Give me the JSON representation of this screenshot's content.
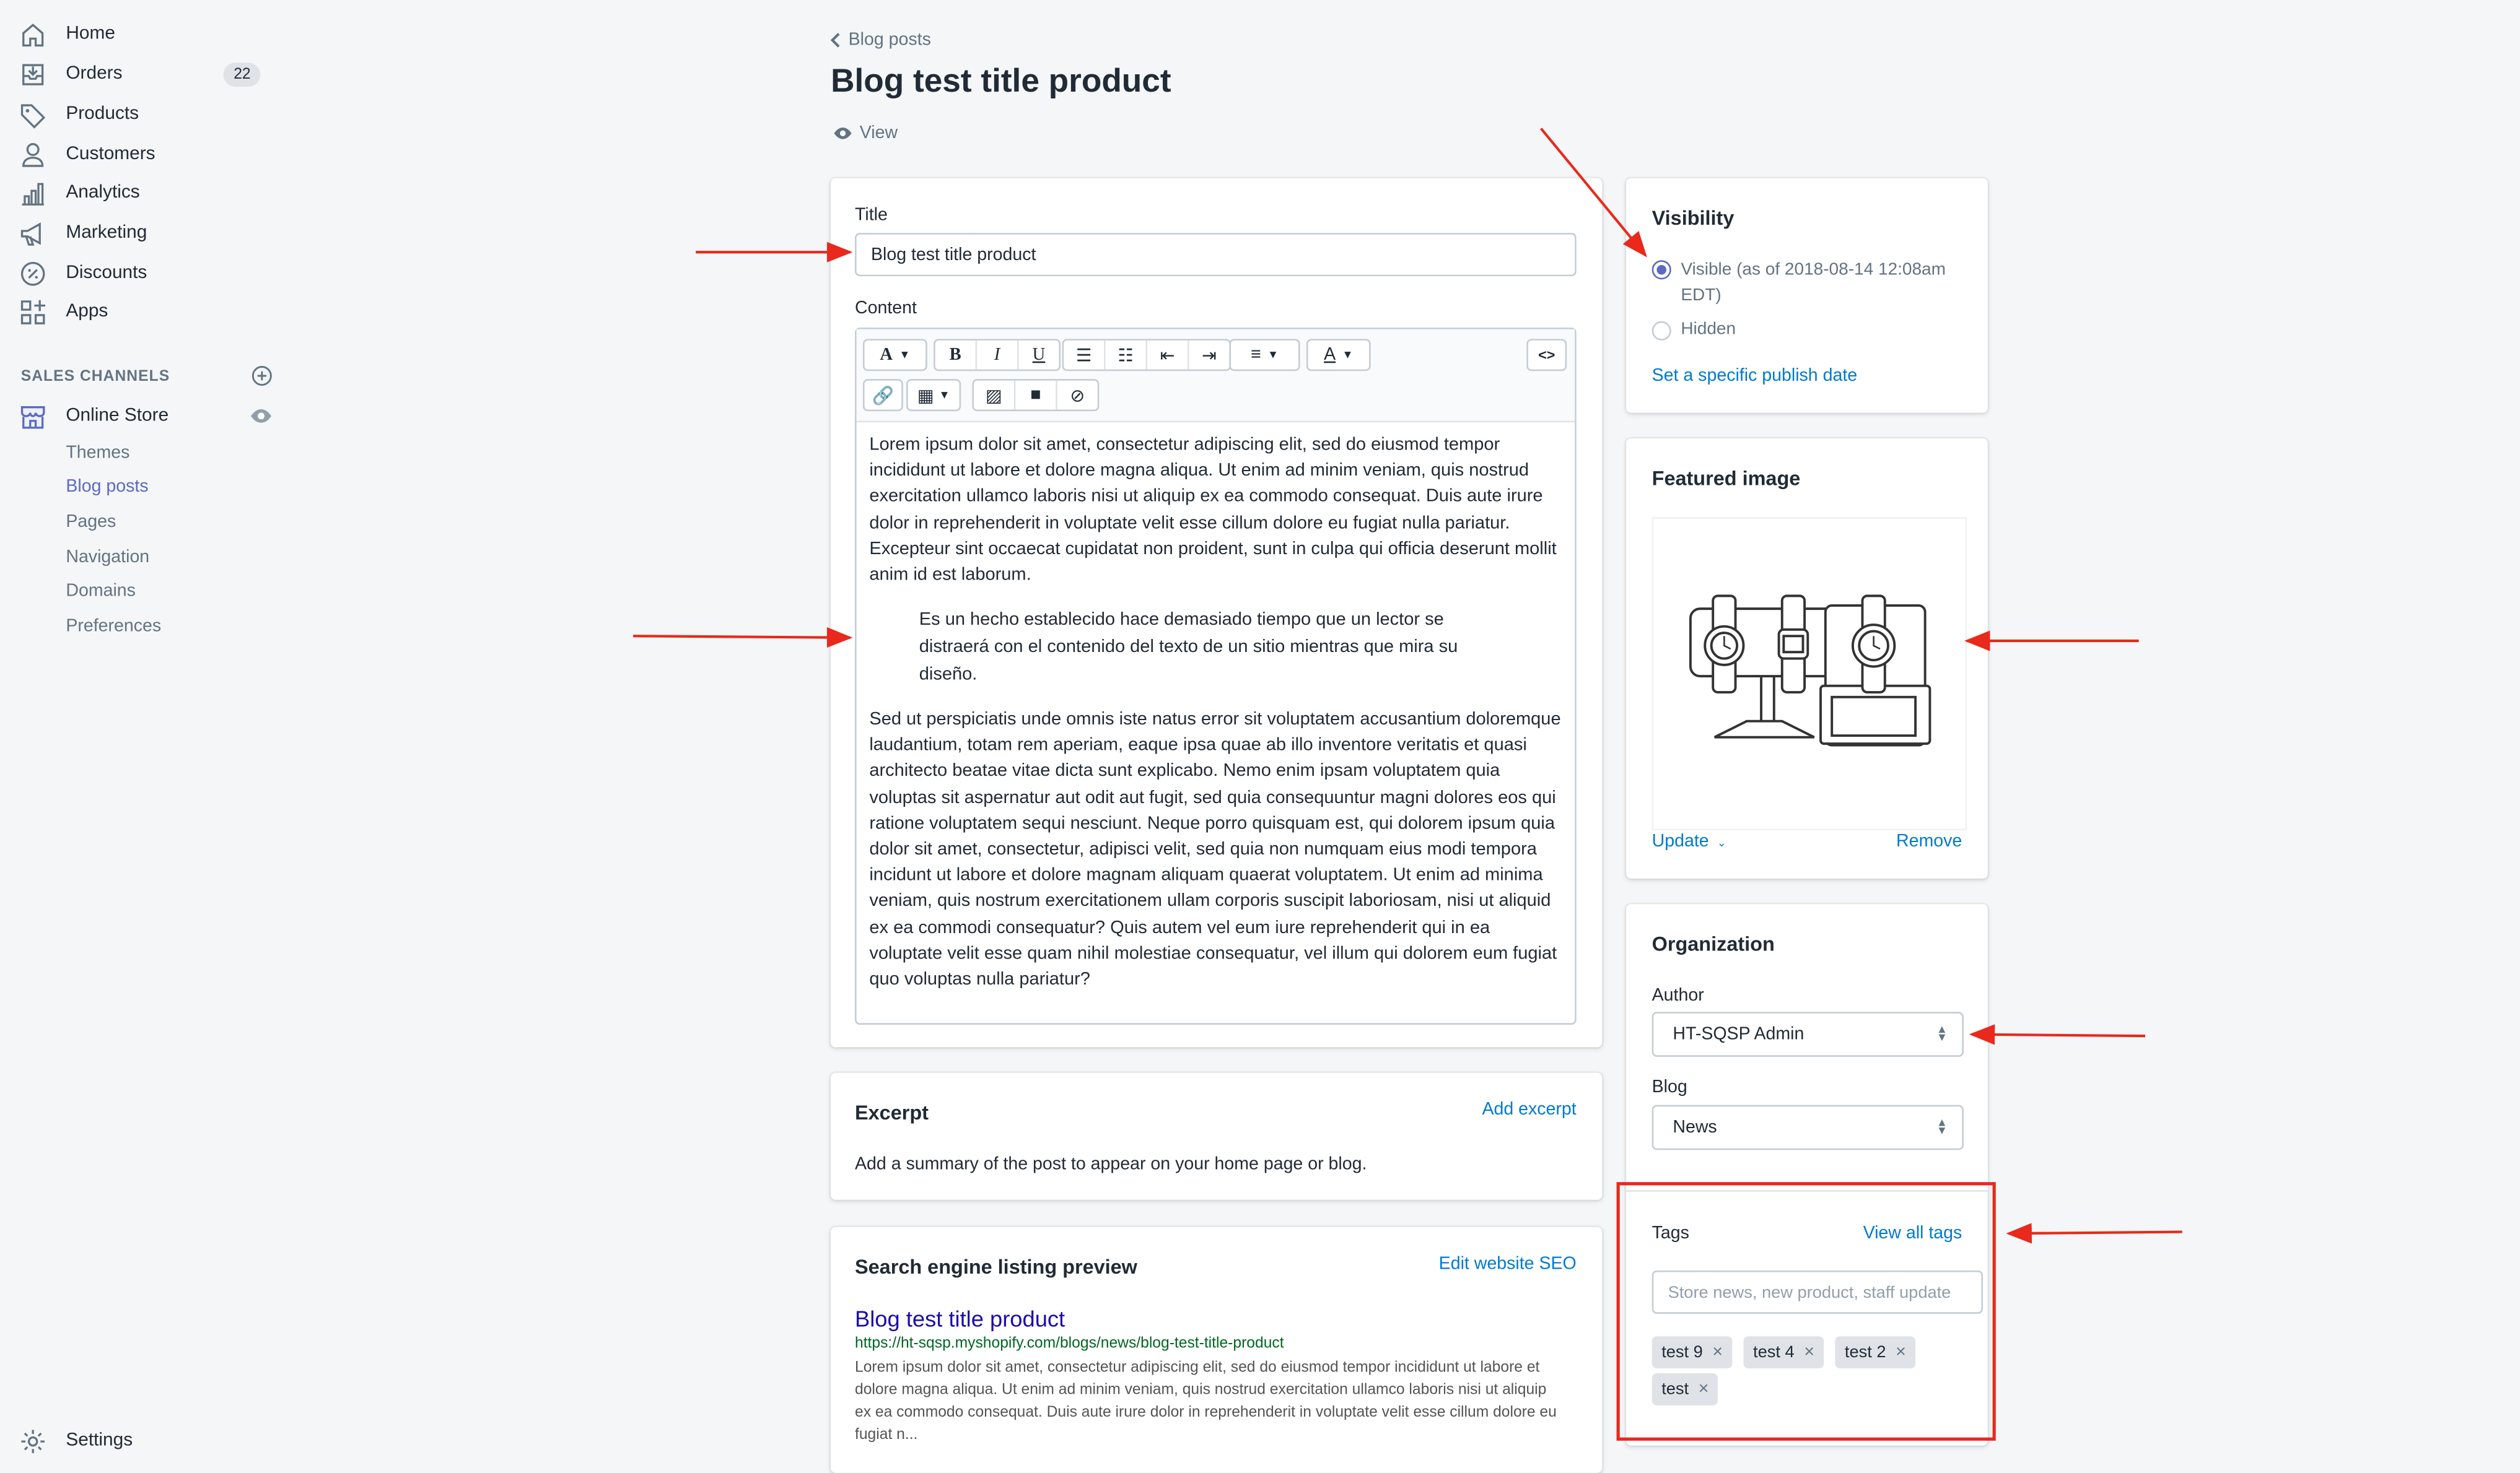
{
  "sidebar": {
    "items": [
      {
        "label": "Home",
        "icon": "home-icon"
      },
      {
        "label": "Orders",
        "icon": "orders-icon",
        "badge": "22"
      },
      {
        "label": "Products",
        "icon": "tag-icon"
      },
      {
        "label": "Customers",
        "icon": "person-icon"
      },
      {
        "label": "Analytics",
        "icon": "bar-chart-icon"
      },
      {
        "label": "Marketing",
        "icon": "megaphone-icon"
      },
      {
        "label": "Discounts",
        "icon": "discount-icon"
      },
      {
        "label": "Apps",
        "icon": "apps-icon"
      }
    ],
    "sales_channels_title": "SALES CHANNELS",
    "online_store": "Online Store",
    "sub_items": [
      "Themes",
      "Blog posts",
      "Pages",
      "Navigation",
      "Domains",
      "Preferences"
    ],
    "settings": "Settings"
  },
  "header": {
    "breadcrumb": "Blog posts",
    "title": "Blog test title product",
    "view_label": "View"
  },
  "editor": {
    "title_label": "Title",
    "title_value": "Blog test title product",
    "content_label": "Content",
    "html_toggle": "<>",
    "paragraph1": "Lorem ipsum dolor sit amet, consectetur adipiscing elit, sed do eiusmod tempor incididunt ut labore et dolore magna aliqua. Ut enim ad minim veniam, quis nostrud exercitation ullamco laboris nisi ut aliquip ex ea commodo consequat. Duis aute irure dolor in reprehenderit in voluptate velit esse cillum dolore eu fugiat nulla pariatur. Excepteur sint occaecat cupidatat non proident, sunt in culpa qui officia deserunt mollit anim id est laborum.",
    "quote": "Es un hecho establecido hace demasiado tiempo que un lector se distraerá con el contenido del texto de un sitio mientras que mira su diseño.",
    "paragraph2": "Sed ut perspiciatis unde omnis iste natus error sit voluptatem accusantium doloremque laudantium, totam rem aperiam, eaque ipsa quae ab illo inventore veritatis et quasi architecto beatae vitae dicta sunt explicabo. Nemo enim ipsam voluptatem quia voluptas sit aspernatur aut odit aut fugit, sed quia consequuntur magni dolores eos qui ratione voluptatem sequi nesciunt. Neque porro quisquam est, qui dolorem ipsum quia dolor sit amet, consectetur, adipisci velit, sed quia non numquam eius modi tempora incidunt ut labore et dolore magnam aliquam quaerat voluptatem. Ut enim ad minima veniam, quis nostrum exercitationem ullam corporis suscipit laboriosam, nisi ut aliquid ex ea commodi consequatur? Quis autem vel eum iure reprehenderit qui in ea voluptate velit esse quam nihil molestiae consequatur, vel illum qui dolorem eum fugiat quo voluptas nulla pariatur?"
  },
  "excerpt": {
    "title": "Excerpt",
    "action": "Add excerpt",
    "description": "Add a summary of the post to appear on your home page or blog."
  },
  "seo": {
    "title": "Search engine listing preview",
    "action": "Edit website SEO",
    "preview_title": "Blog test title product",
    "preview_url": "https://ht-sqsp.myshopify.com/blogs/news/blog-test-title-product",
    "preview_description": "Lorem ipsum dolor sit amet, consectetur adipiscing elit, sed do eiusmod tempor incididunt ut labore et dolore magna aliqua. Ut enim ad minim veniam, quis nostrud exercitation ullamco laboris nisi ut aliquip ex ea commodo consequat. Duis aute irure dolor in reprehenderit in voluptate velit esse cillum dolore eu fugiat n..."
  },
  "visibility": {
    "title": "Visibility",
    "visible_label": "Visible (as of 2018-08-14 12:08am EDT)",
    "hidden_label": "Hidden",
    "publish_link": "Set a specific publish date"
  },
  "featured_image": {
    "title": "Featured image",
    "update": "Update",
    "remove": "Remove"
  },
  "organization": {
    "title": "Organization",
    "author_label": "Author",
    "author_value": "HT-SQSP Admin",
    "blog_label": "Blog",
    "blog_value": "News"
  },
  "tags": {
    "title": "Tags",
    "view_all": "View all tags",
    "placeholder": "Store news, new product, staff update",
    "items": [
      "test 9",
      "test 4",
      "test 2",
      "test"
    ]
  },
  "colors": {
    "accent": "#5c6ac4",
    "link": "#007ace",
    "annotation": "#e8291c"
  }
}
